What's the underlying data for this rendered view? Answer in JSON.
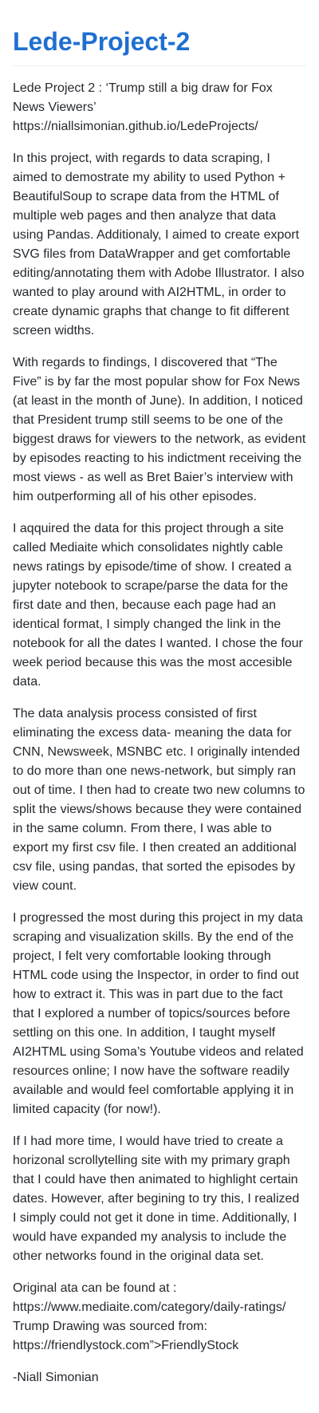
{
  "title": "Lede-Project-2",
  "intro": {
    "line1": "Lede Project 2 : ‘Trump still a big draw for Fox News Viewers’",
    "link": "https://niallsimonian.github.io/LedeProjects/"
  },
  "paragraphs": [
    "In this project, with regards to data scraping, I aimed to demostrate my ability to used Python + BeautifulSoup to scrape data from the HTML of multiple web pages and then analyze that data using Pandas. Additionaly, I aimed to create export SVG files from DataWrapper and get comfortable editing/annotating them with Adobe Illustrator. I also wanted to play around with AI2HTML, in order to create dynamic graphs that change to fit different screen widths.",
    "With regards to findings, I discovered that “The Five” is by far the most popular show for Fox News (at least in the month of June). In addition, I noticed that President trump still seems to be one of the biggest draws for viewers to the network, as evident by episodes reacting to his indictment receiving the most views - as well as Bret Baier’s interview with him outperforming all of his other episodes.",
    "I aqquired the data for this project through a site called Mediaite which consolidates nightly cable news ratings by episode/time of show. I created a jupyter notebook to scrape/parse the data for the first date and then, because each page had an identical format, I simply changed the link in the notebook for all the dates I wanted. I chose the four week period because this was the most accesible data.",
    "The data analysis process consisted of first eliminating the excess data- meaning the data for CNN, Newsweek, MSNBC etc. I originally intended to do more than one news-network, but simply ran out of time. I then had to create two new columns to split the views/shows because they were contained in the same column. From there, I was able to export my first csv file. I then created an additional csv file, using pandas, that sorted the episodes by view count.",
    "I progressed the most during this project in my data scraping and visualization skills. By the end of the project, I felt very comfortable looking through HTML code using the Inspector, in order to find out how to extract it. This was in part due to the fact that I explored a number of topics/sources before settling on this one. In addition, I taught myself AI2HTML using Soma’s Youtube videos and related resources online; I now have the software readily available and would feel comfortable applying it in limited capacity (for now!).",
    "If I had more time, I would have tried to create a horizonal scrollytelling site with my primary graph that I could have then animated to highlight certain dates. However, after begining to try this, I realized I simply could not get it done in time. Additionally, I would have expanded my analysis to include the other networks found in the original data set."
  ],
  "sources": {
    "line1": "Original ata can be found at :",
    "link1": "https://www.mediaite.com/category/daily-ratings/",
    "line2": "Trump Drawing was sourced from:",
    "link2": "https://friendlystock.com”>FriendlyStock"
  },
  "signature": "-Niall Simonian",
  "colors": {
    "title": "#1f6fd1",
    "text": "#24292e",
    "rule": "#eaecef"
  }
}
